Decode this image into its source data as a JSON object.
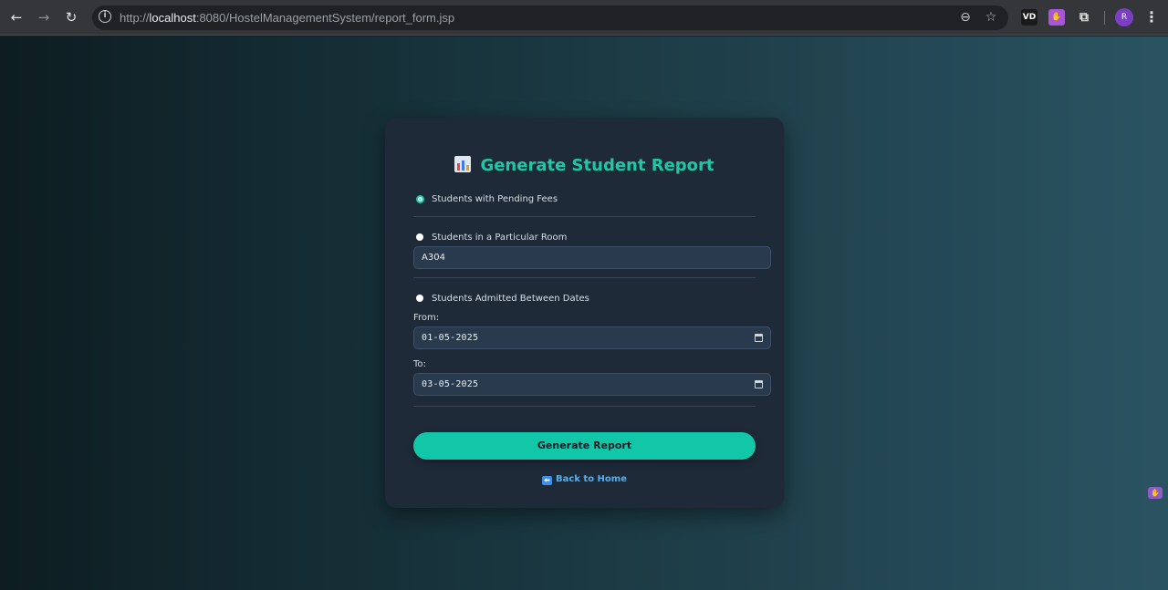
{
  "browser": {
    "url_prefix": "http://",
    "url_host": "localhost",
    "url_rest": ":8080/HostelManagementSystem/report_form.jsp",
    "back_icon": "←",
    "forward_icon": "→",
    "reload_icon": "↻",
    "zoom_icon": "⊖",
    "star_icon": "☆",
    "ext_vd_label": "VD",
    "ext_puzzle_icon": "⧉",
    "profile_initial": "R",
    "menu_icon": "⋮"
  },
  "report": {
    "title": "Generate Student Report",
    "options": {
      "pending_fees": "Students with Pending Fees",
      "particular_room": "Students in a Particular Room",
      "between_dates": "Students Admitted Between Dates"
    },
    "room_value": "A304",
    "from_label": "From:",
    "from_value": "01-05-2025",
    "to_label": "To:",
    "to_value": "03-05-2025",
    "generate_label": "Generate Report",
    "back_label": "Back to Home",
    "selected_option": "pending_fees"
  },
  "colors": {
    "accent": "#1ec8a6",
    "link": "#4fb2f5",
    "card": "#1e2a38"
  }
}
